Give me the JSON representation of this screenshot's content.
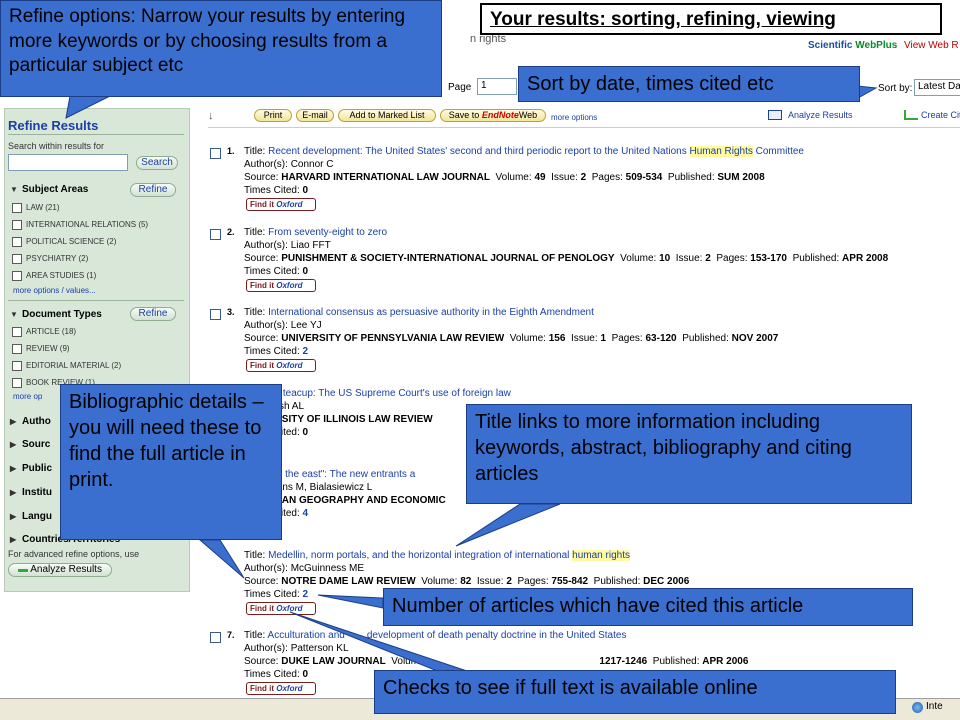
{
  "header": {
    "title_callout": "Your results: sorting, refining, viewing",
    "partial_query_text": "n rights",
    "page_label": "Page",
    "page_value": "1",
    "logo_text": "Scientific",
    "logo_brand": "WebPlus",
    "view_web_link": "View Web R",
    "sort_label": "Sort by:",
    "sort_selected": "Latest Da"
  },
  "sidebar": {
    "title": "Refine Results",
    "search_label": "Search within results for",
    "search_placeholder": "",
    "search_button": "Search",
    "refine_button": "Refine",
    "subject_areas": {
      "label": "Subject Areas",
      "items": [
        "LAW (21)",
        "INTERNATIONAL RELATIONS (5)",
        "POLITICAL SCIENCE (2)",
        "PSYCHIATRY (2)",
        "AREA STUDIES (1)"
      ],
      "more": "more options / values..."
    },
    "document_types": {
      "label": "Document Types",
      "items": [
        "ARTICLE (18)",
        "REVIEW (9)",
        "EDITORIAL MATERIAL (2)",
        "BOOK REVIEW (1)"
      ],
      "more": "more op"
    },
    "collapsed_sections": [
      "Autho",
      "Sourc",
      "Public",
      "Institu",
      "Langu"
    ],
    "countries_section": "Countries/Territories",
    "advanced_label": "For advanced refine options, use",
    "analyze_button": "Analyze Results"
  },
  "toolbar": {
    "print": "Print",
    "email": "E-mail",
    "add_marked": "Add to Marked List",
    "save_to": "Save to",
    "endnote": "EndNote",
    "web": "Web",
    "more_options": "more options",
    "analyze": "Analyze Results",
    "create": "Create Cit"
  },
  "labels": {
    "title": "Title:",
    "authors": "Author(s):",
    "source": "Source:",
    "volume": "Volume:",
    "issue": "Issue:",
    "pages": "Pages:",
    "published": "Published:",
    "times_cited": "Times Cited:",
    "findit_a": "Find it",
    "findit_b": "Oxford"
  },
  "records": [
    {
      "num": "1.",
      "title_pre": "Recent development: The United States' second and third periodic report to the United Nations ",
      "title_hl": "Human Rights",
      "title_post": " Committee",
      "authors": "Connor C",
      "source": "HARVARD INTERNATIONAL LAW JOURNAL",
      "volume": "49",
      "issue": "2",
      "pages": "509-534",
      "published": "SUM 2008",
      "times_cited": "0"
    },
    {
      "num": "2.",
      "title_pre": "From seventy-eight to zero",
      "title_hl": "",
      "title_post": "",
      "authors": "Liao FFT",
      "source": "PUNISHMENT & SOCIETY-INTERNATIONAL JOURNAL OF PENOLOGY",
      "volume": "10",
      "issue": "2",
      "pages": "153-170",
      "published": "APR 2008",
      "times_cited": "0"
    },
    {
      "num": "3.",
      "title_pre": "International consensus as persuasive authority in the Eighth Amendment",
      "title_hl": "",
      "title_post": "",
      "authors": "Lee YJ",
      "source": "UNIVERSITY OF PENNSYLVANIA LAW REVIEW",
      "volume": "156",
      "issue": "1",
      "pages": "63-120",
      "published": "NOV 2007",
      "times_cited": "2"
    },
    {
      "num": "",
      "title_pre": "orm in a teacup: The US Supreme Court's use of foreign law",
      "authors_partial": "s): Parrish AL",
      "source_partial": "UNIVERSITY OF ILLINOIS LAW REVIEW",
      "times_cited": "0"
    },
    {
      "num": "",
      "title_pre": "rouble in the east\": The new entrants a",
      "authors_partial": "s): Feakins M, Bialasiewicz L",
      "source_partial": "EURASIAN GEOGRAPHY AND ECONOMIC",
      "times_cited": "4"
    },
    {
      "num": "",
      "title_pre": "Medellin, norm portals, and the horizontal integration of international ",
      "title_hl": "human rights",
      "title_post": "",
      "authors": "McGuinness ME",
      "source": "NOTRE DAME LAW REVIEW",
      "volume": "82",
      "issue": "2",
      "pages": "755-842",
      "published": "DEC 2006",
      "times_cited": "2"
    },
    {
      "num": "7.",
      "title_pre": "Acculturation and",
      "title_post": "development of death penalty doctrine in the United States",
      "authors": "Patterson KL",
      "source": "DUKE LAW JOURNAL",
      "volume_label_partial": "Volume:",
      "pages_partial": "1217-1246",
      "published": "APR 2006",
      "times_cited": "0"
    }
  ],
  "callouts": {
    "refine": "Refine options: Narrow your results by entering more keywords or by choosing results from a particular subject etc",
    "sort": "Sort by date,  times cited etc",
    "biblio": "Bibliographic details – you will need these to find the full article in print.",
    "title_links": "Title links to more information including keywords, abstract, bibliography and citing articles",
    "cited": "Number of articles which have cited this article",
    "fulltext": "Checks to see if full text is available online"
  },
  "statusbar": {
    "zone": "Inte"
  },
  "colors": {
    "callout_bg": "#3b6fcf",
    "link": "#1a3fa8",
    "sidebar_bg": "#d9e7d9",
    "highlight": "#fffaa0"
  }
}
